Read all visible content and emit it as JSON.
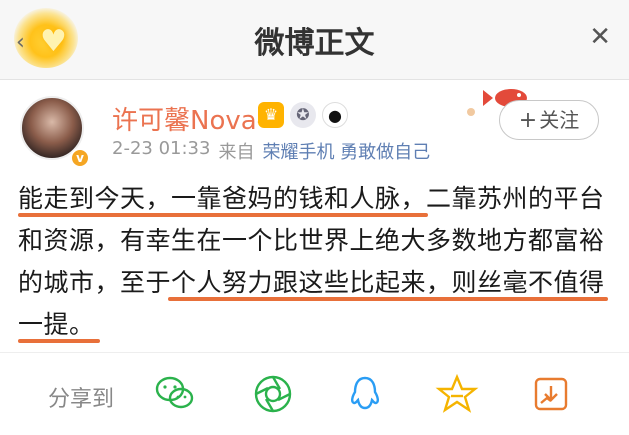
{
  "nav": {
    "title": "微博正文",
    "back_glyph": "‹",
    "close_glyph": "✕"
  },
  "post": {
    "author": {
      "name": "许可馨Nova-",
      "avatar_badge": "v"
    },
    "meta": {
      "time": "2-23 01:33",
      "source_prefix": "来自",
      "source": "荣耀手机 勇敢做自己"
    },
    "follow_label": "关注",
    "follow_plus": "+",
    "text_lines": [
      "能走到今天，一靠爸妈的钱和人脉，二靠苏州的平台",
      "和资源，有幸生在一个比世界上绝大多数地方都富裕",
      "的城市，至于个人努力跟这些比起来，则丝毫不值得",
      "一提。"
    ]
  },
  "share": {
    "label": "分享到",
    "targets": [
      {
        "name": "wechat-icon"
      },
      {
        "name": "moments-icon"
      },
      {
        "name": "qq-icon"
      },
      {
        "name": "qzone-icon"
      },
      {
        "name": "save-image-icon"
      }
    ]
  },
  "colors": {
    "username": "#eb7350",
    "underline": "#e8703a",
    "share_icon": "#2bb24c",
    "qq_icon": "#2a9df4",
    "qzone_icon": "#f5b400",
    "save_icon": "#e87b2f"
  }
}
